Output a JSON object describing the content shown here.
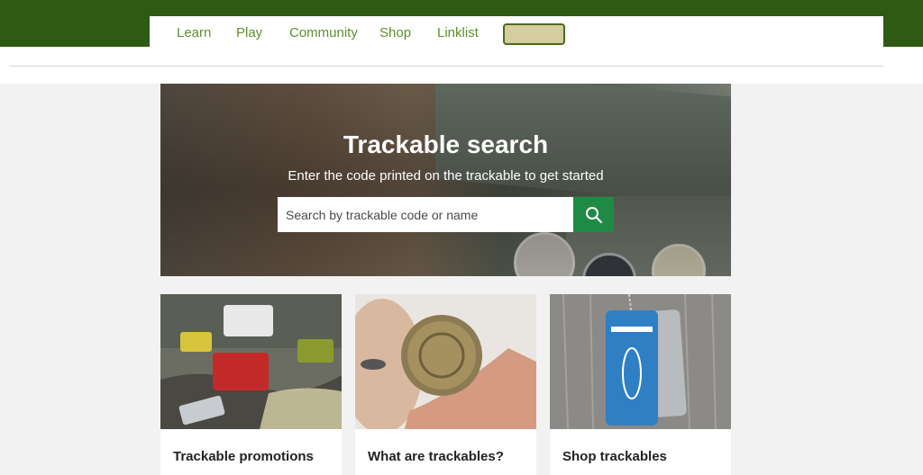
{
  "nav": {
    "items": [
      {
        "label": "Learn"
      },
      {
        "label": "Play"
      },
      {
        "label": "Community"
      },
      {
        "label": "Shop"
      },
      {
        "label": "Linklist"
      }
    ],
    "button_label": ""
  },
  "hero": {
    "title": "Trackable search",
    "subtitle": "Enter the code printed on the trackable to get started",
    "search": {
      "placeholder": "Search by trackable code or name",
      "value": ""
    }
  },
  "cards": [
    {
      "label": "Trackable promotions"
    },
    {
      "label": "What are trackables?"
    },
    {
      "label": "Shop trackables"
    }
  ],
  "icons": {
    "search_button": "search-icon"
  },
  "colors": {
    "header": "#2f5a14",
    "nav_link": "#5f8f2c",
    "search_button": "#1f8a45",
    "nav_button": "#d3cda0"
  }
}
